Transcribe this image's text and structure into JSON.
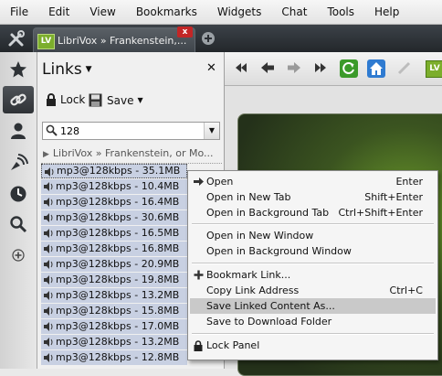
{
  "menubar": {
    "items": [
      "File",
      "Edit",
      "View",
      "Bookmarks",
      "Widgets",
      "Chat",
      "Tools",
      "Help"
    ]
  },
  "tabbar": {
    "tab_favicon": "LV",
    "tab_title": "LibriVox » Frankenstein,...",
    "tab_close": "x"
  },
  "panel": {
    "title": "Links",
    "close": "✕",
    "lock_label": "Lock",
    "save_label": "Save",
    "search_value": "128",
    "group_label": "LibriVox » Frankenstein, or Mo...",
    "links": [
      "mp3@128kbps - 35.1MB",
      "mp3@128kbps - 10.4MB",
      "mp3@128kbps - 16.4MB",
      "mp3@128kbps - 30.6MB",
      "mp3@128kbps - 16.5MB",
      "mp3@128kbps - 16.8MB",
      "mp3@128kbps - 20.9MB",
      "mp3@128kbps - 19.8MB",
      "mp3@128kbps - 13.2MB",
      "mp3@128kbps - 15.8MB",
      "mp3@128kbps - 17.0MB",
      "mp3@128kbps - 13.2MB",
      "mp3@128kbps - 12.8MB"
    ]
  },
  "navbar": {
    "address_favicon": "LV"
  },
  "context_menu": {
    "items": [
      {
        "label": "Open",
        "shortcut": "Enter"
      },
      {
        "label": "Open in New Tab",
        "shortcut": "Shift+Enter"
      },
      {
        "label": "Open in Background Tab",
        "shortcut": "Ctrl+Shift+Enter"
      },
      {
        "label": "Open in New Window",
        "shortcut": ""
      },
      {
        "label": "Open in Background Window",
        "shortcut": ""
      },
      {
        "label": "Bookmark Link...",
        "shortcut": ""
      },
      {
        "label": "Copy Link Address",
        "shortcut": "Ctrl+C"
      },
      {
        "label": "Save Linked Content As...",
        "shortcut": ""
      },
      {
        "label": "Save to Download Folder",
        "shortcut": ""
      },
      {
        "label": "Lock Panel",
        "shortcut": ""
      }
    ]
  },
  "colors": {
    "tabbar": "#2c3035",
    "selection": "#c8d0e2",
    "menu_highlight": "#c9c9c9",
    "librivox_green": "#7cae2c"
  }
}
